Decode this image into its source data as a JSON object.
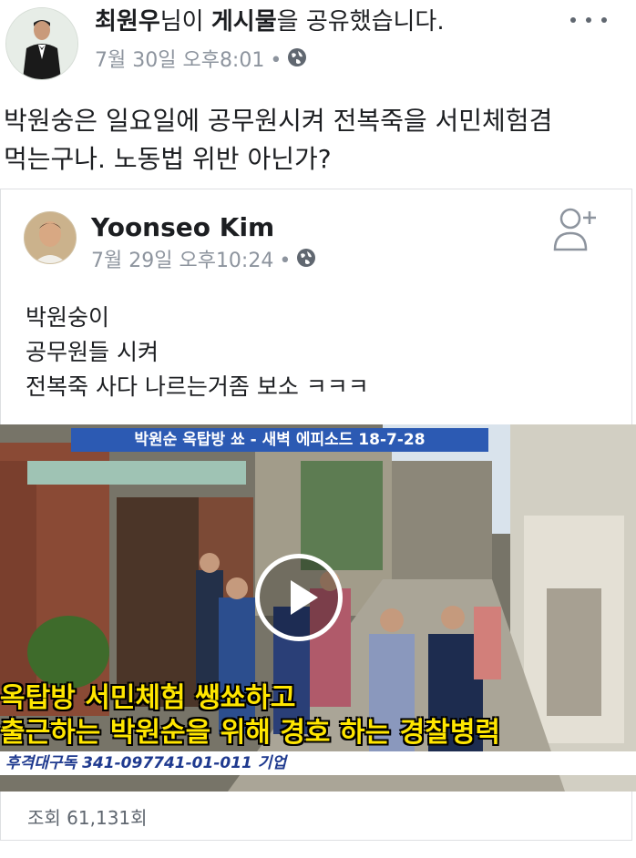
{
  "share_header": {
    "sharer_name": "최원우",
    "text_part1": "님이 ",
    "object": "게시물",
    "text_part2": "을 공유했습니다.",
    "timestamp": "7월 30일 오후8:01",
    "separator": "•",
    "privacy_icon": "globe-icon",
    "more_icon": "more-horizontal-icon"
  },
  "post": {
    "text": "박원숭은 일요일에 공무원시켜 전복죽을 서민체험겸\n먹는구나. 노동법 위반 아닌가?"
  },
  "shared_post": {
    "author": "Yoonseo Kim",
    "timestamp": "7월 29일 오후10:24",
    "separator": "•",
    "privacy_icon": "globe-icon",
    "add_friend_icon": "add-friend-icon",
    "text": "박원숭이\n공무원들 시켜\n전복죽 사다 나르는거좀 보소 ㅋㅋㅋ"
  },
  "video": {
    "banner": "박원순 옥탑방 쑈 - 새벽 에피소드 18-7-28",
    "caption_line1": "옥탑방 서민체험 쌩쑈하고",
    "caption_line2": "출근하는 박원순을 위해 경호 하는 경찰병력",
    "ticker": "후격대구독 341-097741-01-011 기업",
    "play_icon": "play-icon"
  },
  "views": "조회 61,131회",
  "colors": {
    "text": "#1c1e21",
    "meta": "#8d949e",
    "banner": "#2c5ab3",
    "caption": "#ffe600"
  }
}
